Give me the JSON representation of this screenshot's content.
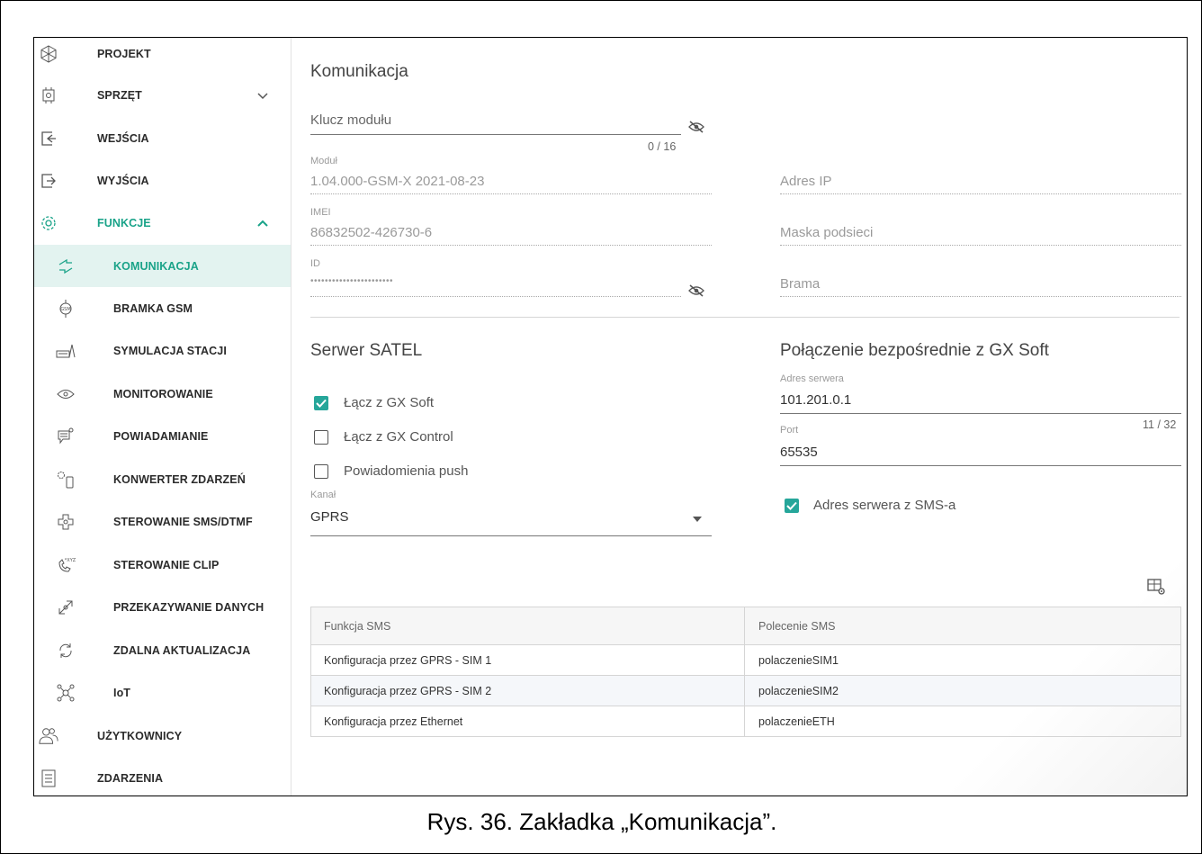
{
  "sidebar": {
    "items": [
      {
        "label": "PROJEKT",
        "icon": "project-icon"
      },
      {
        "label": "SPRZĘT",
        "icon": "hardware-icon"
      },
      {
        "label": "WEJŚCIA",
        "icon": "inputs-icon"
      },
      {
        "label": "WYJŚCIA",
        "icon": "outputs-icon"
      },
      {
        "label": "FUNKCJE",
        "icon": "functions-gear-icon"
      },
      {
        "label": "KOMUNIKACJA",
        "icon": "communication-icon"
      },
      {
        "label": "BRAMKA GSM",
        "icon": "gsm-gateway-icon"
      },
      {
        "label": "SYMULACJA STACJI",
        "icon": "station-simulation-icon"
      },
      {
        "label": "MONITOROWANIE",
        "icon": "monitoring-eye-icon"
      },
      {
        "label": "POWIADAMIANIE",
        "icon": "notification-icon"
      },
      {
        "label": "KONWERTER ZDARZEŃ",
        "icon": "event-converter-icon"
      },
      {
        "label": "STEROWANIE SMS/DTMF",
        "icon": "sms-dtmf-control-icon"
      },
      {
        "label": "STEROWANIE CLIP",
        "icon": "clip-control-icon"
      },
      {
        "label": "PRZEKAZYWANIE DANYCH",
        "icon": "data-forwarding-icon"
      },
      {
        "label": "ZDALNA AKTUALIZACJA",
        "icon": "remote-update-icon"
      },
      {
        "label": "IoT",
        "icon": "iot-icon"
      },
      {
        "label": "UŻYTKOWNICY",
        "icon": "users-icon"
      },
      {
        "label": "ZDARZENIA",
        "icon": "events-icon"
      }
    ]
  },
  "main": {
    "title": "Komunikacja",
    "module_key": {
      "label": "Klucz modułu",
      "counter": "0 / 16"
    },
    "module": {
      "label": "Moduł",
      "value": "1.04.000-GSM-X 2021-08-23"
    },
    "imei": {
      "label": "IMEI",
      "value": "86832502-426730-6"
    },
    "id": {
      "label": "ID",
      "value": "•••••••••••••••••••••••"
    },
    "ip_address": {
      "label": "Adres IP"
    },
    "subnet_mask": {
      "label": "Maska podsieci"
    },
    "gateway": {
      "label": "Brama"
    },
    "satel": {
      "title": "Serwer SATEL",
      "connect_gx_soft": {
        "label": "Łącz z GX Soft",
        "checked": true
      },
      "connect_gx_control": {
        "label": "Łącz z GX Control",
        "checked": false
      },
      "push": {
        "label": "Powiadomienia push",
        "checked": false
      },
      "channel": {
        "label": "Kanał",
        "value": "GPRS"
      }
    },
    "direct": {
      "title": "Połączenie bezpośrednie z GX Soft",
      "server_address": {
        "label": "Adres serwera",
        "value": "101.201.0.1",
        "counter": "11 / 32"
      },
      "port": {
        "label": "Port",
        "value": "65535"
      },
      "sms_server": {
        "label": "Adres serwera z SMS-a",
        "checked": true
      }
    },
    "table": {
      "headers": [
        "Funkcja SMS",
        "Polecenie SMS"
      ],
      "rows": [
        [
          "Konfiguracja przez GPRS - SIM 1",
          "polaczenieSIM1"
        ],
        [
          "Konfiguracja przez GPRS - SIM 2",
          "polaczenieSIM2"
        ],
        [
          "Konfiguracja przez Ethernet",
          "polaczenieETH"
        ]
      ]
    }
  },
  "caption": "Rys. 36. Zakładka „Komunikacja”.",
  "colors": {
    "accent": "#26a69a",
    "active_bg": "#e3f3f0",
    "active_text": "#1aa389"
  }
}
